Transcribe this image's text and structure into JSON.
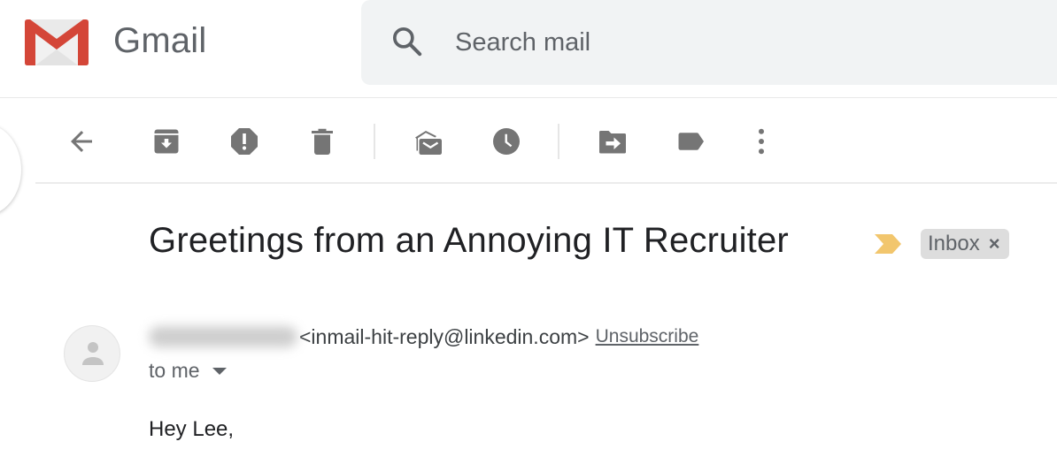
{
  "app": {
    "name": "Gmail",
    "brand_color": "#d44638"
  },
  "search": {
    "placeholder": "Search mail",
    "value": ""
  },
  "toolbar": {
    "buttons": [
      {
        "name": "back-to-inbox",
        "icon": "arrow-left-icon",
        "label": "Back to Inbox"
      },
      {
        "name": "archive",
        "icon": "archive-icon",
        "label": "Archive"
      },
      {
        "name": "report-spam",
        "icon": "report-spam-icon",
        "label": "Report spam"
      },
      {
        "name": "delete",
        "icon": "trash-icon",
        "label": "Delete"
      },
      {
        "name": "mark-unread",
        "icon": "mark-unread-icon",
        "label": "Mark as unread"
      },
      {
        "name": "snooze",
        "icon": "clock-icon",
        "label": "Snooze"
      },
      {
        "name": "move-to",
        "icon": "move-to-icon",
        "label": "Move to"
      },
      {
        "name": "labels",
        "icon": "label-icon",
        "label": "Labels"
      },
      {
        "name": "more",
        "icon": "more-vert-icon",
        "label": "More"
      }
    ],
    "icon_color": "#757575"
  },
  "message": {
    "subject": "Greetings from an Annoying IT Recruiter",
    "importance_marker_color": "#f2c66d",
    "labels": [
      {
        "text": "Inbox",
        "remove": "×"
      }
    ],
    "sender": {
      "name": "[redacted]",
      "email": "<inmail-hit-reply@linkedin.com>",
      "unsubscribe": "Unsubscribe"
    },
    "recipient": "to me",
    "body_first_line": "Hey Lee,"
  }
}
